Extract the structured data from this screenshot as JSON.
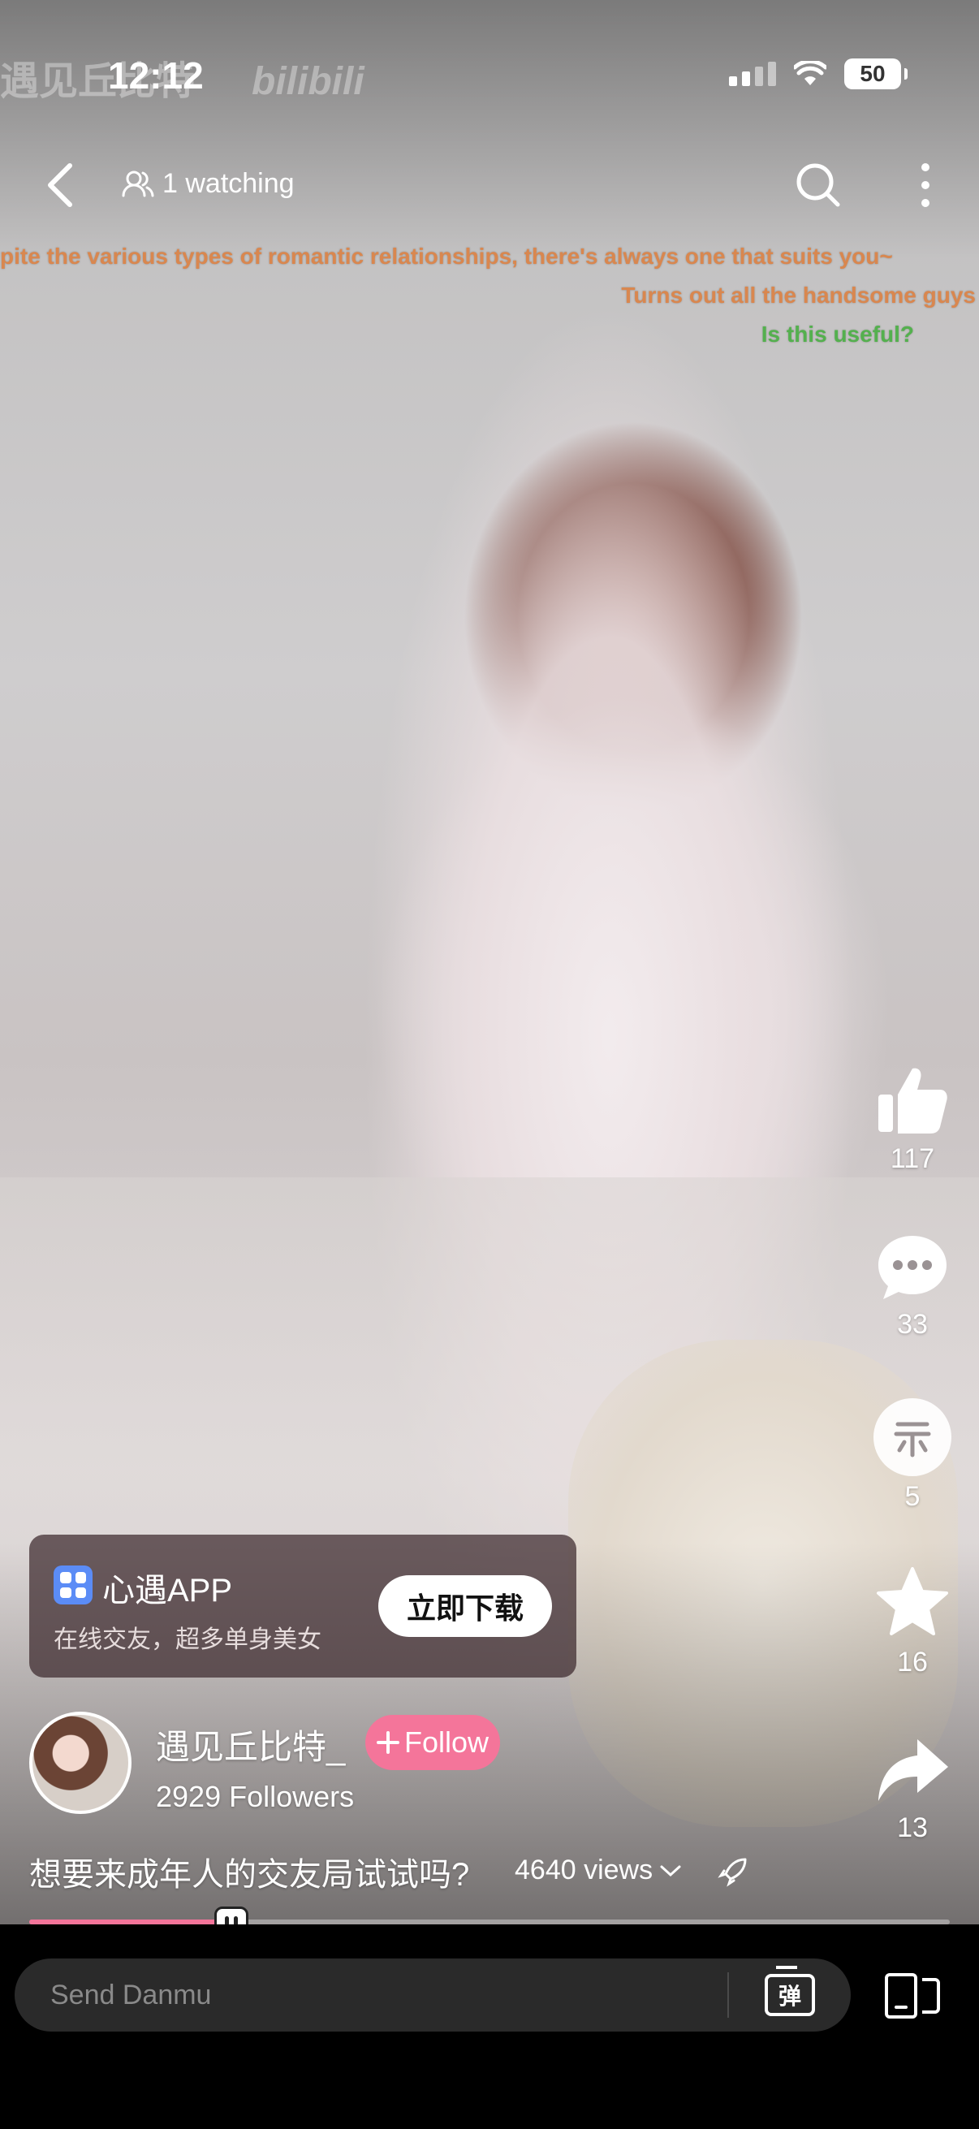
{
  "status_bar": {
    "time": "12:12",
    "battery": "50",
    "watermark_text": "遇见丘比特",
    "watermark_brand": "bilibili"
  },
  "nav": {
    "watching": "1 watching"
  },
  "danmu": [
    "pite the various types of romantic relationships, there's always one that suits you~",
    "Turns out all the handsome guys",
    "Is this useful?"
  ],
  "actions": {
    "likes": "117",
    "comments": "33",
    "coins": "5",
    "favorites": "16",
    "shares": "13"
  },
  "ad": {
    "title": "心遇APP",
    "subtitle": "在线交友，超多单身美女",
    "button": "立即下载"
  },
  "uploader": {
    "name": "遇见丘比特_",
    "follow_label": "Follow",
    "followers": "2929 Followers"
  },
  "video": {
    "title": "想要来成年人的交友局试试吗?",
    "views": "4640 views",
    "progress": 0.22
  },
  "bottom": {
    "danmu_placeholder": "Send Danmu",
    "danmu_toggle_label": "弹"
  },
  "colors": {
    "accent": "#f4759a",
    "danmu_orange": "#d9874f",
    "danmu_green": "#54b04e",
    "ad_icon": "#5b8cf6"
  }
}
